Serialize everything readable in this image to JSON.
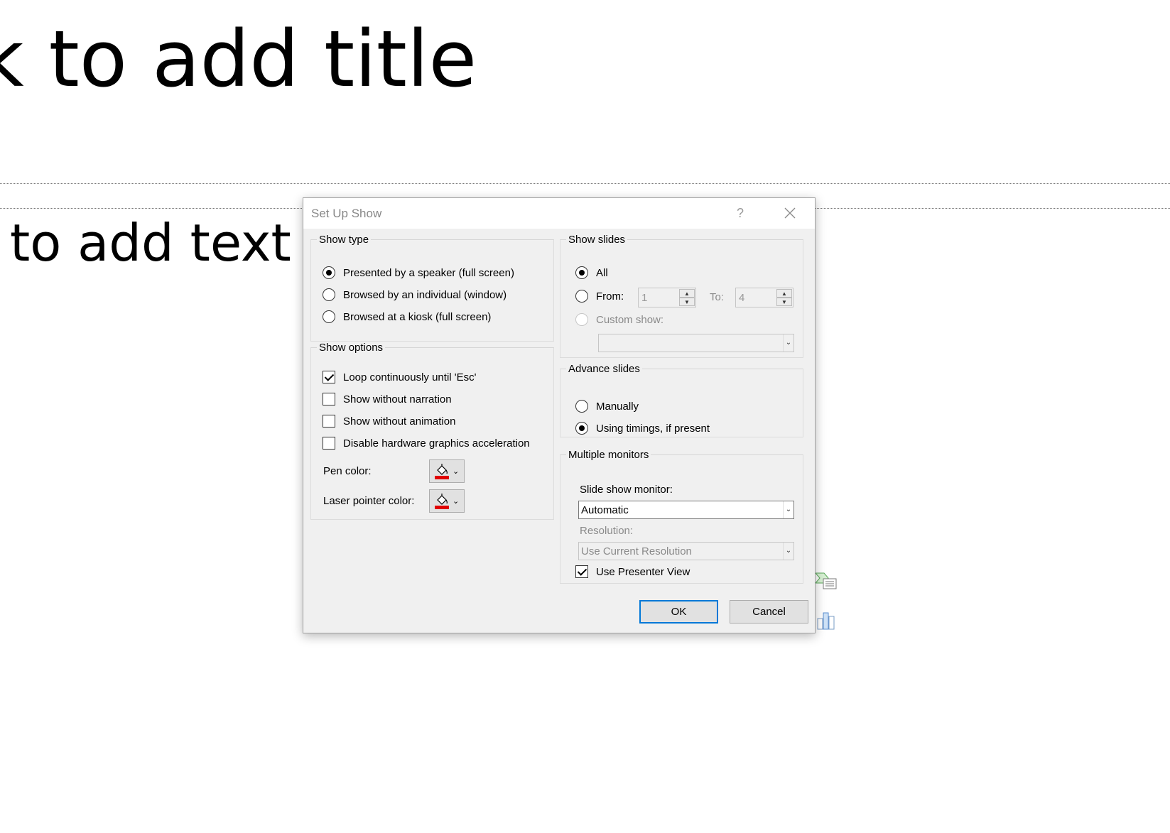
{
  "slide": {
    "title_placeholder": "k to add title",
    "text_placeholder": "to add text"
  },
  "dialog": {
    "title": "Set Up Show",
    "help_glyph": "?",
    "close_glyph": "✕",
    "show_type": {
      "legend": "Show type",
      "options": [
        {
          "label": "Presented by a speaker (full screen)",
          "checked": true
        },
        {
          "label": "Browsed by an individual (window)",
          "checked": false
        },
        {
          "label": "Browsed at a kiosk (full screen)",
          "checked": false
        }
      ]
    },
    "show_options": {
      "legend": "Show options",
      "checks": [
        {
          "label": "Loop continuously until 'Esc'",
          "checked": true
        },
        {
          "label": "Show without narration",
          "checked": false
        },
        {
          "label": "Show without animation",
          "checked": false
        },
        {
          "label": "Disable hardware graphics acceleration",
          "checked": false
        }
      ],
      "pen_color_label": "Pen color:",
      "laser_color_label": "Laser pointer color:",
      "pen_color": "#e00000",
      "laser_color": "#e00000"
    },
    "show_slides": {
      "legend": "Show slides",
      "all_label": "All",
      "from_label": "From:",
      "from_value": "1",
      "to_label": "To:",
      "to_value": "4",
      "custom_label": "Custom show:",
      "custom_value": ""
    },
    "advance_slides": {
      "legend": "Advance slides",
      "manually_label": "Manually",
      "timings_label": "Using timings, if present"
    },
    "monitors": {
      "legend": "Multiple monitors",
      "monitor_label": "Slide show monitor:",
      "monitor_value": "Automatic",
      "resolution_label": "Resolution:",
      "resolution_value": "Use Current Resolution",
      "presenter_view_label": "Use Presenter View",
      "presenter_view_checked": true
    },
    "ok_label": "OK",
    "cancel_label": "Cancel"
  }
}
